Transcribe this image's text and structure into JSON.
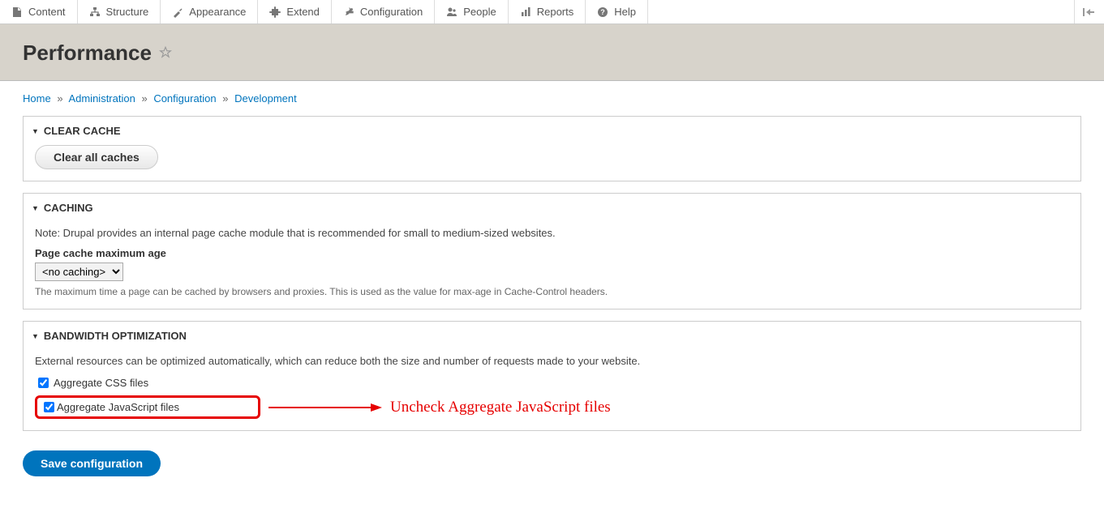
{
  "toolbar": {
    "items": [
      {
        "label": "Content"
      },
      {
        "label": "Structure"
      },
      {
        "label": "Appearance"
      },
      {
        "label": "Extend"
      },
      {
        "label": "Configuration"
      },
      {
        "label": "People"
      },
      {
        "label": "Reports"
      },
      {
        "label": "Help"
      }
    ]
  },
  "page": {
    "title": "Performance"
  },
  "breadcrumb": {
    "items": [
      "Home",
      "Administration",
      "Configuration",
      "Development"
    ]
  },
  "sections": {
    "clear_cache": {
      "title": "Clear cache",
      "button": "Clear all caches"
    },
    "caching": {
      "title": "Caching",
      "note": "Note: Drupal provides an internal page cache module that is recommended for small to medium-sized websites.",
      "field_label": "Page cache maximum age",
      "selected": "<no caching>",
      "description": "The maximum time a page can be cached by browsers and proxies. This is used as the value for max-age in Cache-Control headers."
    },
    "bandwidth": {
      "title": "Bandwidth optimization",
      "note": "External resources can be optimized automatically, which can reduce both the size and number of requests made to your website.",
      "css_label": "Aggregate CSS files",
      "js_label": "Aggregate JavaScript files"
    }
  },
  "annotation": {
    "text": "Uncheck Aggregate JavaScript files"
  },
  "actions": {
    "save": "Save configuration"
  }
}
